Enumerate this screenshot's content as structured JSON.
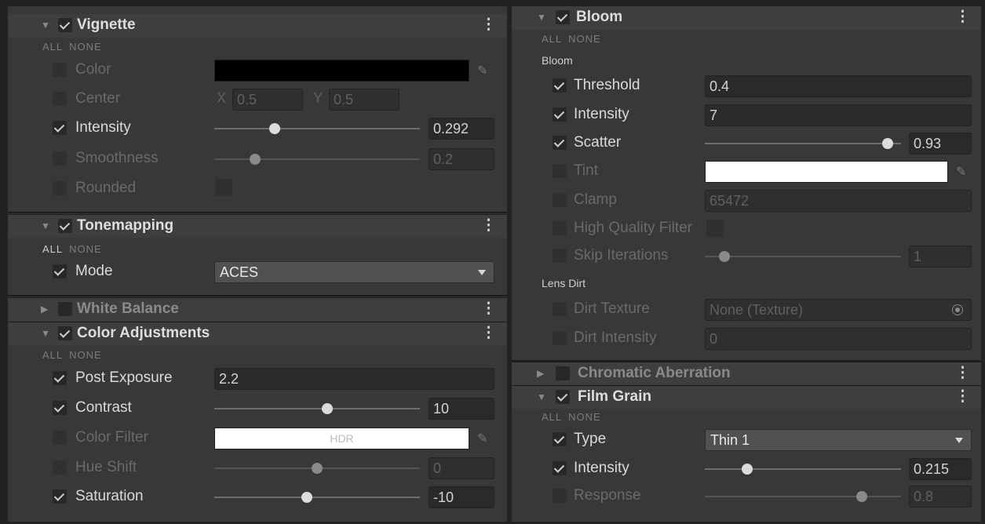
{
  "left_panel": {
    "vignette": {
      "title": "Vignette",
      "all": "ALL",
      "none": "NONE",
      "color_label": "Color",
      "color_value": "#000000",
      "center_label": "Center",
      "center_x_label": "X",
      "center_x": "0.5",
      "center_y_label": "Y",
      "center_y": "0.5",
      "intensity_label": "Intensity",
      "intensity_value": "0.292",
      "intensity_fraction": 0.292,
      "smoothness_label": "Smoothness",
      "smoothness_value": "0.2",
      "smoothness_fraction": 0.2,
      "rounded_label": "Rounded"
    },
    "tonemapping": {
      "title": "Tonemapping",
      "all": "ALL",
      "none": "NONE",
      "mode_label": "Mode",
      "mode_value": "ACES"
    },
    "white_balance": {
      "title": "White Balance"
    },
    "color_adjustments": {
      "title": "Color Adjustments",
      "all": "ALL",
      "none": "NONE",
      "post_exposure_label": "Post Exposure",
      "post_exposure_value": "2.2",
      "contrast_label": "Contrast",
      "contrast_value": "10",
      "color_filter_label": "Color Filter",
      "color_filter_hdr": "HDR",
      "color_filter_value": "#ffffff",
      "hue_shift_label": "Hue Shift",
      "hue_shift_value": "0",
      "saturation_label": "Saturation",
      "saturation_value": "-10"
    }
  },
  "right_panel": {
    "bloom": {
      "title": "Bloom",
      "all": "ALL",
      "none": "NONE",
      "group_bloom": "Bloom",
      "threshold_label": "Threshold",
      "threshold_value": "0.4",
      "intensity_label": "Intensity",
      "intensity_value": "7",
      "scatter_label": "Scatter",
      "scatter_value": "0.93",
      "scatter_fraction": 0.93,
      "tint_label": "Tint",
      "tint_value": "#ffffff",
      "clamp_label": "Clamp",
      "clamp_value": "65472",
      "hq_filter_label": "High Quality Filter",
      "skip_iterations_label": "Skip Iterations",
      "skip_iterations_value": "1",
      "group_lens_dirt": "Lens Dirt",
      "dirt_texture_label": "Dirt Texture",
      "dirt_texture_value": "None (Texture)",
      "dirt_intensity_label": "Dirt Intensity",
      "dirt_intensity_value": "0"
    },
    "chromatic_aberration": {
      "title": "Chromatic Aberration"
    },
    "film_grain": {
      "title": "Film Grain",
      "all": "ALL",
      "none": "NONE",
      "type_label": "Type",
      "type_value": "Thin 1",
      "intensity_label": "Intensity",
      "intensity_value": "0.215",
      "intensity_fraction": 0.215,
      "response_label": "Response",
      "response_value": "0.8",
      "response_fraction": 0.8
    }
  },
  "colors": {
    "panel_bg": "#383838",
    "header_bg": "#3e3e3e",
    "field_bg": "#2a2a2a",
    "text": "#dadada",
    "disabled_text": "#6a6a6a"
  },
  "icons": {
    "expanded": "triangle-down",
    "collapsed": "triangle-right",
    "menu": "kebab-vertical",
    "eyedropper": "eyedropper",
    "object_picker": "target-circle"
  }
}
